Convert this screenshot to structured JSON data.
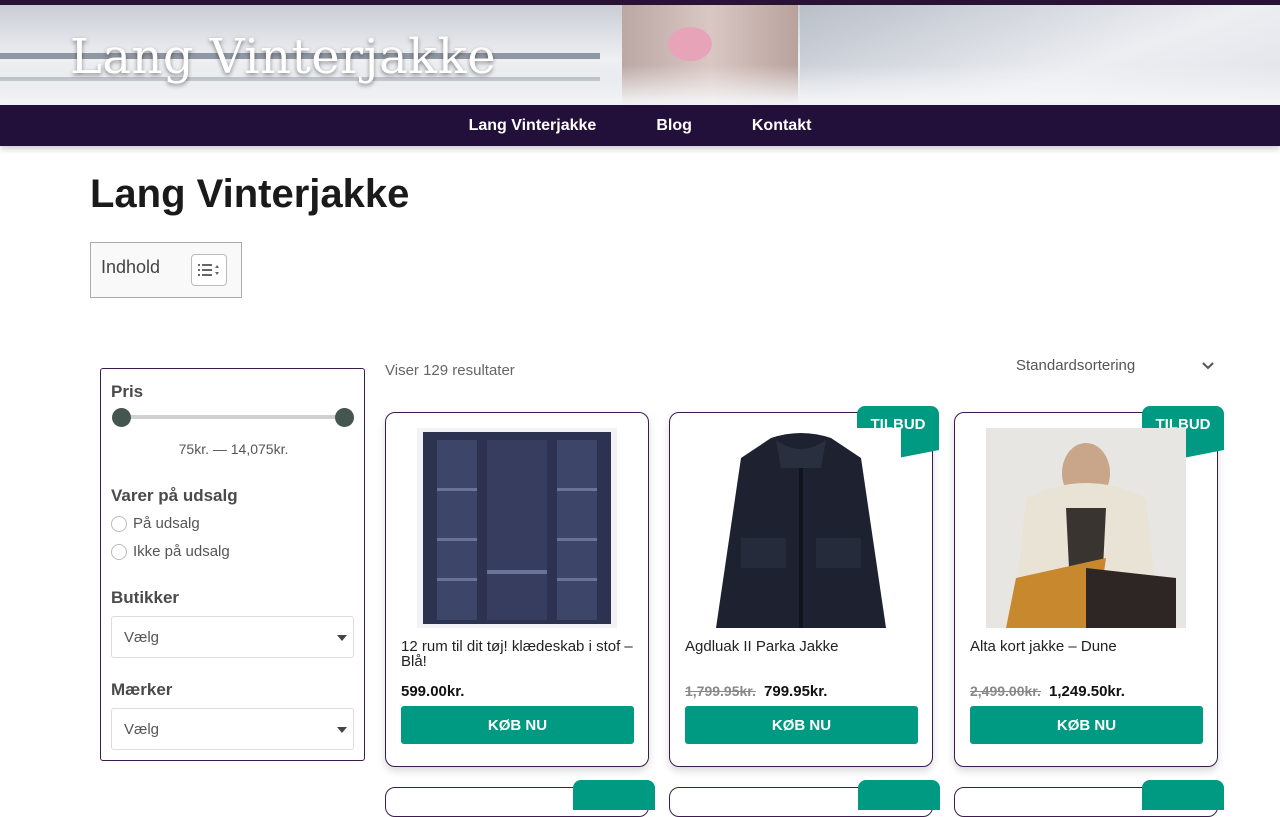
{
  "site": {
    "title": "Lang  Vinterjakke"
  },
  "nav": {
    "items": [
      "Lang Vinterjakke",
      "Blog",
      "Kontakt"
    ]
  },
  "page": {
    "title": "Lang Vinterjakke"
  },
  "toc": {
    "label": "Indhold"
  },
  "sidebar": {
    "price_heading": "Pris",
    "price_range": "75kr. — 14,075kr.",
    "sale_heading": "Varer på udsalg",
    "sale_options": [
      "På udsalg",
      "Ikke på udsalg"
    ],
    "stores_heading": "Butikker",
    "stores_select": "Vælg",
    "brands_heading": "Mærker",
    "brands_select": "Vælg"
  },
  "shop": {
    "results": "Viser 129 resultater",
    "sort": "Standardsortering",
    "products": [
      {
        "name": "12 rum til dit tøj! klædeskab i stof – Blå!",
        "old_price": "",
        "price": "599.00kr.",
        "badge": "",
        "button": "KØB NU"
      },
      {
        "name": "Agdluak II Parka Jakke",
        "old_price": "1,799.95kr.",
        "price": "799.95kr.",
        "badge": "TILBUD",
        "button": "KØB NU"
      },
      {
        "name": "Alta kort jakke – Dune",
        "old_price": "2,499.00kr.",
        "price": "1,249.50kr.",
        "badge": "TILBUD",
        "button": "KØB NU"
      }
    ]
  },
  "colors": {
    "nav_bg": "#22103a",
    "accent": "#009982",
    "border": "#3d1b4f"
  }
}
